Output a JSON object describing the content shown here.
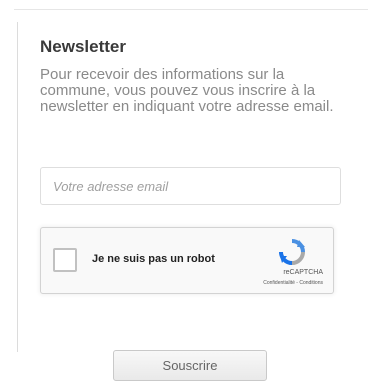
{
  "newsletter": {
    "title": "Newsletter",
    "description": "Pour recevoir des informations sur la commune, vous pouvez vous inscrire à la newsletter en indiquant votre adresse email.",
    "email_placeholder": "Votre adresse email",
    "email_value": "",
    "submit_label": "Souscrire"
  },
  "recaptcha": {
    "label": "Je ne suis pas un robot",
    "brand": "reCAPTCHA",
    "links": "Confidentialité - Conditions",
    "icon": "recaptcha-logo-icon"
  },
  "colors": {
    "title": "#3a3a3a",
    "description": "#8a8a8a",
    "recaptcha_blue": "#4a90e2"
  }
}
